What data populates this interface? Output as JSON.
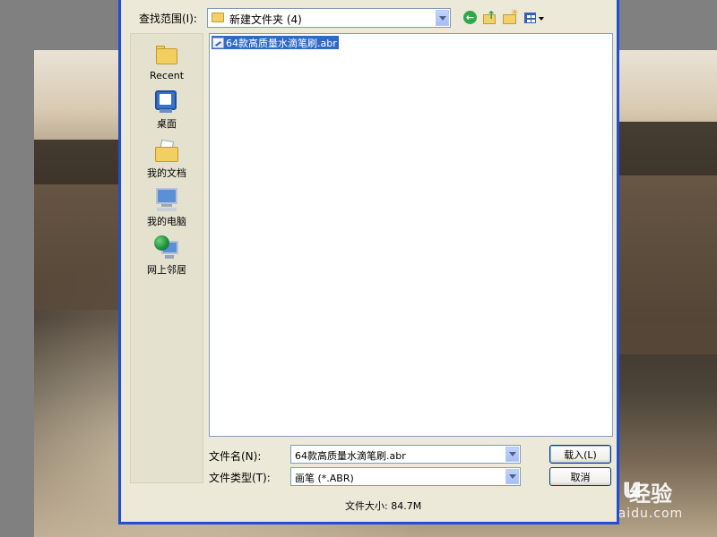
{
  "dialog": {
    "look_in_label": "查找范围(I):",
    "look_in_value": "新建文件夹 (4)"
  },
  "toolbar": {
    "icons": [
      "back-icon",
      "up-folder-icon",
      "new-folder-icon",
      "views-menu-icon"
    ]
  },
  "places": [
    {
      "label": "Recent",
      "icon": "recent-folder-icon"
    },
    {
      "label": "桌面",
      "icon": "desktop-icon"
    },
    {
      "label": "我的文档",
      "icon": "my-documents-icon"
    },
    {
      "label": "我的电脑",
      "icon": "my-computer-icon"
    },
    {
      "label": "网上邻居",
      "icon": "network-places-icon"
    }
  ],
  "files": [
    {
      "name": "64款高质量水滴笔刷.abr",
      "selected": true
    }
  ],
  "filename": {
    "label": "文件名(N):",
    "value": "64款高质量水滴笔刷.abr"
  },
  "filetype": {
    "label": "文件类型(T):",
    "value": "画笔 (*.ABR)"
  },
  "buttons": {
    "load": "载入(L)",
    "cancel": "取消"
  },
  "file_size": "文件大小: 84.7M",
  "watermark": {
    "logo": "Baidu",
    "jingyan": "经验",
    "url": "jingyan.baidu.com"
  },
  "colors": {
    "selection": "#316ac5",
    "dialog_bg": "#ece9d8",
    "title_border": "#1f4fd6"
  }
}
